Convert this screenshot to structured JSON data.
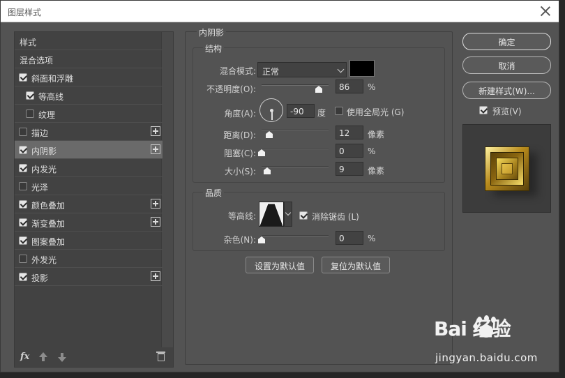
{
  "dialog": {
    "title": "图层样式"
  },
  "style_list": {
    "items": [
      {
        "label": "样式"
      },
      {
        "label": "混合选项"
      },
      {
        "label": "斜面和浮雕",
        "checked": true
      },
      {
        "label": "等高线",
        "checked": true
      },
      {
        "label": "纹理",
        "checked": false
      },
      {
        "label": "描边",
        "checked": false,
        "plus": true
      },
      {
        "label": "内阴影",
        "checked": true,
        "plus": true,
        "selected": true
      },
      {
        "label": "内发光",
        "checked": true
      },
      {
        "label": "光泽",
        "checked": false
      },
      {
        "label": "颜色叠加",
        "checked": true,
        "plus": true
      },
      {
        "label": "渐变叠加",
        "checked": true,
        "plus": true
      },
      {
        "label": "图案叠加",
        "checked": true
      },
      {
        "label": "外发光",
        "checked": false
      },
      {
        "label": "投影",
        "checked": true,
        "plus": true
      }
    ],
    "fx_label": "fx"
  },
  "inner_shadow": {
    "section_title": "内阴影",
    "structure": {
      "title": "结构",
      "blend_mode_label": "混合模式:",
      "blend_mode_value": "正常",
      "shadow_color": "#000000",
      "opacity_label": "不透明度(O):",
      "opacity_value": "86",
      "opacity_unit": "%",
      "angle_label": "角度(A):",
      "angle_value": "-90",
      "angle_unit": "度",
      "global_light_label": "使用全局光 (G)",
      "global_light_checked": false,
      "distance_label": "距离(D):",
      "distance_value": "12",
      "distance_unit": "像素",
      "choke_label": "阻塞(C):",
      "choke_value": "0",
      "choke_unit": "%",
      "size_label": "大小(S):",
      "size_value": "9",
      "size_unit": "像素"
    },
    "quality": {
      "title": "品质",
      "contour_label": "等高线:",
      "antialias_label": "消除锯齿 (L)",
      "antialias_checked": true,
      "noise_label": "杂色(N):",
      "noise_value": "0",
      "noise_unit": "%"
    },
    "set_default_label": "设置为默认值",
    "reset_default_label": "复位为默认值"
  },
  "actions": {
    "ok_label": "确定",
    "cancel_label": "取消",
    "new_style_label": "新建样式(W)...",
    "preview_label": "预览(V)",
    "preview_checked": true
  },
  "watermark": {
    "logo": "Bai  经验",
    "url": "jingyan.baidu.com"
  }
}
